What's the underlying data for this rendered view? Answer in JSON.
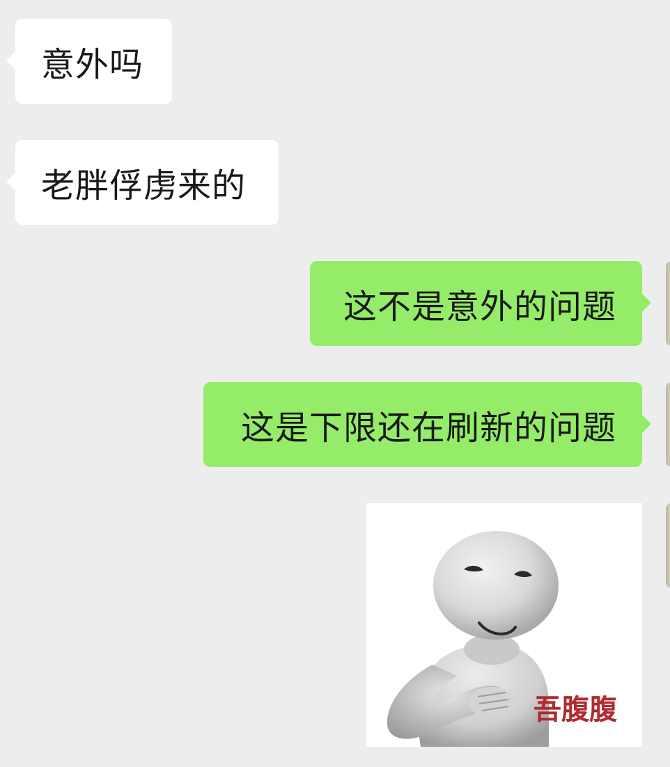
{
  "messages": [
    {
      "id": "m1",
      "direction": "incoming",
      "text": "意外吗"
    },
    {
      "id": "m2",
      "direction": "incoming",
      "text": "老胖俘虏来的"
    },
    {
      "id": "m3",
      "direction": "outgoing",
      "text": "这不是意外的问题"
    },
    {
      "id": "m4",
      "direction": "outgoing",
      "text": "这是下限还在刷新的问题"
    },
    {
      "id": "m5",
      "direction": "outgoing",
      "type": "sticker",
      "sticker_caption": "吾腹腹",
      "sticker_icon": "smug-figure-belly-rub"
    }
  ],
  "colors": {
    "background": "#ededed",
    "incoming_bubble": "#ffffff",
    "outgoing_bubble": "#95ec69",
    "text": "#191919",
    "sticker_caption": "#b02a2f"
  }
}
